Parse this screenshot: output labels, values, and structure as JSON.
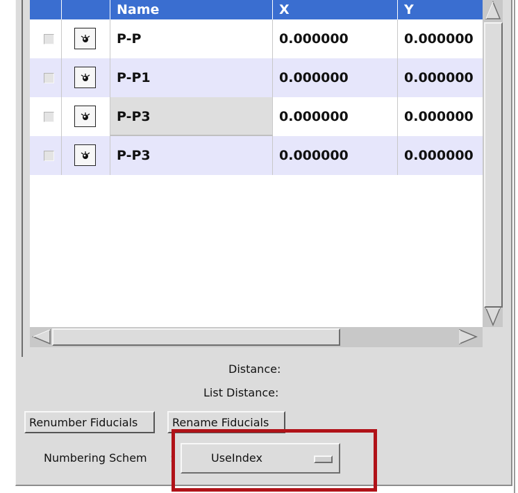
{
  "table": {
    "columns": [
      "",
      "",
      "Name",
      "X",
      "Y"
    ],
    "rows": [
      {
        "name": "P-P",
        "x": "0.000000",
        "y": "0.000000"
      },
      {
        "name": "P-P1",
        "x": "0.000000",
        "y": "0.000000"
      },
      {
        "name": "P-P3",
        "x": "0.000000",
        "y": "0.000000"
      },
      {
        "name": "P-P3",
        "x": "0.000000",
        "y": "0.000000"
      }
    ]
  },
  "info": {
    "distance_label": "Distance:",
    "list_distance_label": "List Distance:"
  },
  "buttons": {
    "renumber": "Renumber Fiducials",
    "rename": "Rename Fiducials"
  },
  "numbering": {
    "label": "Numbering Schem",
    "colon": ":",
    "value": "UseIndex"
  },
  "colors": {
    "header_bg": "#3a6ed0",
    "alt_row": "#e6e6fb",
    "highlight_border": "#b01218"
  },
  "icons": [
    "eye-icon",
    "checkbox",
    "scroll-up-arrow",
    "scroll-down-arrow",
    "scroll-left-arrow",
    "scroll-right-arrow"
  ]
}
